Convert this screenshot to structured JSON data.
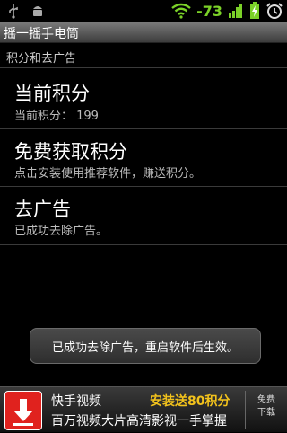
{
  "status_bar": {
    "signal_text": "-73",
    "colors": {
      "signal": "#7bd128"
    }
  },
  "app": {
    "title": "摇一摇手电筒"
  },
  "section": {
    "header": "积分和去广告"
  },
  "items": [
    {
      "title": "当前积分",
      "summary": "当前积分： 199"
    },
    {
      "title": "免费获取积分",
      "summary": "点击安装使用推荐软件，赚送积分。"
    },
    {
      "title": "去广告",
      "summary": "已成功去除广告。"
    }
  ],
  "toast": {
    "text": "已成功去除广告，重启软件后生效。"
  },
  "ad": {
    "name": "快手视频",
    "promo": "安装送80积分",
    "description": "百万视频大片高清影视一手掌握",
    "download_line1": "免费",
    "download_line2": "下载",
    "colors": {
      "promo": "#f2c21c",
      "icon": "#e0221e"
    }
  }
}
